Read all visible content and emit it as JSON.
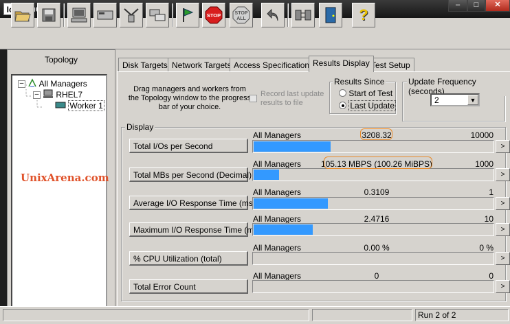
{
  "window": {
    "app_icon": "Io",
    "title": "Iometer",
    "min_glyph": "–",
    "max_glyph": "□",
    "close_glyph": "✕"
  },
  "toolbar": {
    "buttons": [
      {
        "name": "open-config",
        "icon": "folder-open-icon"
      },
      {
        "name": "save-config",
        "icon": "save-icon"
      },
      {
        "name": "new-manager",
        "icon": "computer-icon"
      },
      {
        "name": "new-disk-worker",
        "icon": "disk-worker-icon"
      },
      {
        "name": "new-network-worker",
        "icon": "network-worker-icon"
      },
      {
        "name": "duplicate-worker",
        "icon": "duplicate-icon"
      },
      {
        "name": "start-tests",
        "icon": "green-flag-icon"
      },
      {
        "name": "stop",
        "icon": "stop-sign-icon",
        "label": "STOP"
      },
      {
        "name": "stop-all",
        "icon": "stop-all-icon",
        "label": "STOP",
        "label2": "ALL"
      },
      {
        "name": "reset-workers",
        "icon": "undo-arrow-icon"
      },
      {
        "name": "disconnect",
        "icon": "disconnect-icon"
      },
      {
        "name": "exit",
        "icon": "door-exit-icon"
      },
      {
        "name": "about",
        "icon": "question-icon",
        "label": "?"
      }
    ]
  },
  "topology": {
    "title": "Topology",
    "tree": {
      "root": "All Managers",
      "manager": "RHEL7",
      "worker": "Worker 1"
    }
  },
  "watermark": "UnixArena.com",
  "tabs": [
    {
      "label": "Disk Targets",
      "active": false
    },
    {
      "label": "Network Targets",
      "active": false
    },
    {
      "label": "Access Specifications",
      "active": false
    },
    {
      "label": "Results Display",
      "active": true
    },
    {
      "label": "Test Setup",
      "active": false
    }
  ],
  "results": {
    "drag_hint": "Drag managers and workers from the Topology window to the progress bar of your choice.",
    "record_label": "Record last update results to file",
    "results_since": {
      "legend": "Results Since",
      "options": [
        "Start of Test",
        "Last Update"
      ],
      "selected": "Last Update"
    },
    "update_frequency": {
      "legend": "Update Frequency (seconds)",
      "value": "2"
    },
    "display_legend": "Display",
    "metrics": [
      {
        "label": "Total I/Os per Second",
        "scope": "All Managers",
        "value": "3208.32",
        "max": "10000",
        "fraction": 0.321
      },
      {
        "label": "Total MBs per Second (Decimal)",
        "scope": "All Managers",
        "value": "105.13 MBPS (100.26 MiBPS)",
        "max": "1000",
        "fraction": 0.105
      },
      {
        "label": "Average I/O Response Time (ms)",
        "scope": "All Managers",
        "value": "0.3109",
        "max": "1",
        "fraction": 0.311
      },
      {
        "label": "Maximum I/O Response Time (ms)",
        "scope": "All Managers",
        "value": "2.4716",
        "max": "10",
        "fraction": 0.247
      },
      {
        "label": "% CPU Utilization (total)",
        "scope": "All Managers",
        "value": "0.00 %",
        "max": "0 %",
        "fraction": 0
      },
      {
        "label": "Total Error Count",
        "scope": "All Managers",
        "value": "0",
        "max": "0",
        "fraction": 0
      }
    ],
    "arrow_glyph": ">"
  },
  "status": {
    "run": "Run 2 of 2"
  },
  "colors": {
    "progress": "#3399ff",
    "highlight": "#e88a2a",
    "watermark": "#e0522a"
  }
}
